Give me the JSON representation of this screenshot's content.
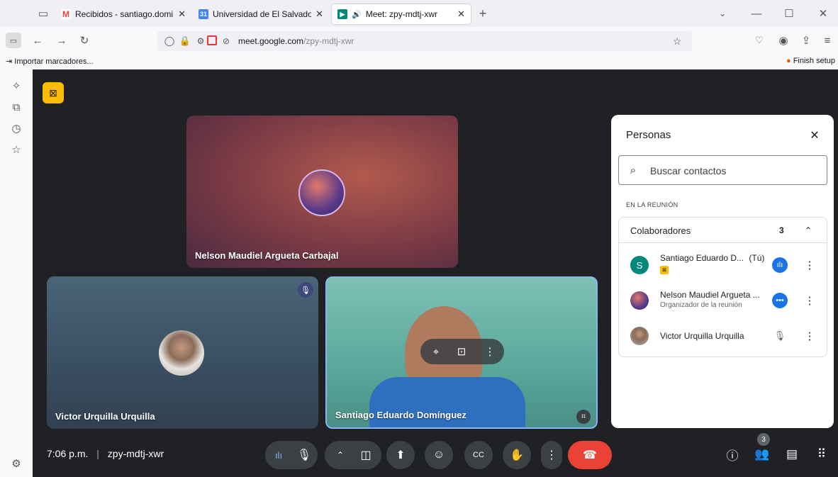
{
  "tabs": [
    {
      "label": "Recibidos - santiago.domingue",
      "favicon": "gmail-icon",
      "active": false
    },
    {
      "label": "Universidad de El Salvador - Ca",
      "favicon": "calendar-icon",
      "active": false
    },
    {
      "label": "Meet: zpy-mdtj-xwr",
      "favicon": "meet-icon",
      "active": true
    }
  ],
  "url": {
    "domain": "meet.google.com",
    "path": "/zpy-mdtj-xwr"
  },
  "bookmarks": {
    "import_label": "Importar marcadores...",
    "finish_label": "Finish setup"
  },
  "tiles": [
    {
      "name": "Nelson Maudiel Argueta Carbajal"
    },
    {
      "name": "Victor Urquilla Urquilla"
    },
    {
      "name": "Santiago Eduardo Domínguez"
    }
  ],
  "people_panel": {
    "title": "Personas",
    "search_placeholder": "Buscar contactos",
    "section_label": "EN LA REUNIÓN",
    "group_label": "Colaboradores",
    "group_count": "3",
    "participants": [
      {
        "name": "Santiago Eduardo D...",
        "suffix": "(Tú)",
        "subtitle": "",
        "initial": "S"
      },
      {
        "name": "Nelson Maudiel Argueta ...",
        "suffix": "",
        "subtitle": "Organizador de la reunión",
        "initial": ""
      },
      {
        "name": "Victor Urquilla Urquilla",
        "suffix": "",
        "subtitle": "",
        "initial": ""
      }
    ]
  },
  "footer": {
    "time": "7:06 p.m.",
    "meeting_code": "zpy-mdtj-xwr",
    "people_badge": "3"
  },
  "colors": {
    "hangup": "#ea4335",
    "accent_blue": "#1a73e8",
    "panel_bg": "#ffffff",
    "meet_bg": "#202124"
  }
}
